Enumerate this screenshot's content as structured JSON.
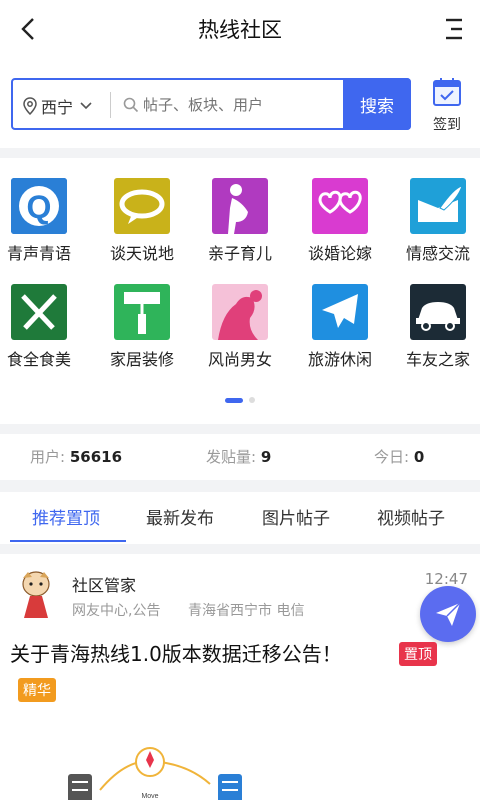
{
  "header": {
    "title": "热线社区"
  },
  "search": {
    "city": "西宁",
    "placeholder": "帖子、板块、用户",
    "button_label": "搜索",
    "signin_label": "签到"
  },
  "categories": [
    {
      "label": "青声青语",
      "icon": "q-speech-icon",
      "color": "#2a7fd6"
    },
    {
      "label": "谈天说地",
      "icon": "chat-bubble-icon",
      "color": "#c9b21a"
    },
    {
      "label": "亲子育儿",
      "icon": "pregnant-icon",
      "color": "#b03ac0"
    },
    {
      "label": "谈婚论嫁",
      "icon": "hearts-icon",
      "color": "#d93bd0"
    },
    {
      "label": "情感交流",
      "icon": "letter-feather-icon",
      "color": "#1fa0d8"
    },
    {
      "label": "食全食美",
      "icon": "fork-knife-icon",
      "color": "#1f7a3a"
    },
    {
      "label": "家居装修",
      "icon": "paint-roller-icon",
      "color": "#2fb45a"
    },
    {
      "label": "风尚男女",
      "icon": "fashion-woman-icon",
      "color": "#e0407a"
    },
    {
      "label": "旅游休闲",
      "icon": "airplane-icon",
      "color": "#1f8fe0"
    },
    {
      "label": "车友之家",
      "icon": "car-icon",
      "color": "#1c2b36"
    }
  ],
  "stats": {
    "users_label": "用户:",
    "users_value": "56616",
    "posts_label": "发贴量:",
    "posts_value": "9",
    "today_label": "今日:",
    "today_value": "0"
  },
  "tabs": [
    "推荐置顶",
    "最新发布",
    "图片帖子",
    "视频帖子"
  ],
  "post": {
    "author": "社区管家",
    "meta": "网友中心,公告",
    "location": "青海省西宁市 电信",
    "time": "12:47",
    "title": "关于青海热线1.0版本数据迁移公告！",
    "badge_top": "置顶",
    "badge_essence": "精华",
    "illustration_text": "Move"
  },
  "colors": {
    "accent": "#3f67ef",
    "top_badge": "#e8344b",
    "essence_badge": "#f29b1f"
  }
}
